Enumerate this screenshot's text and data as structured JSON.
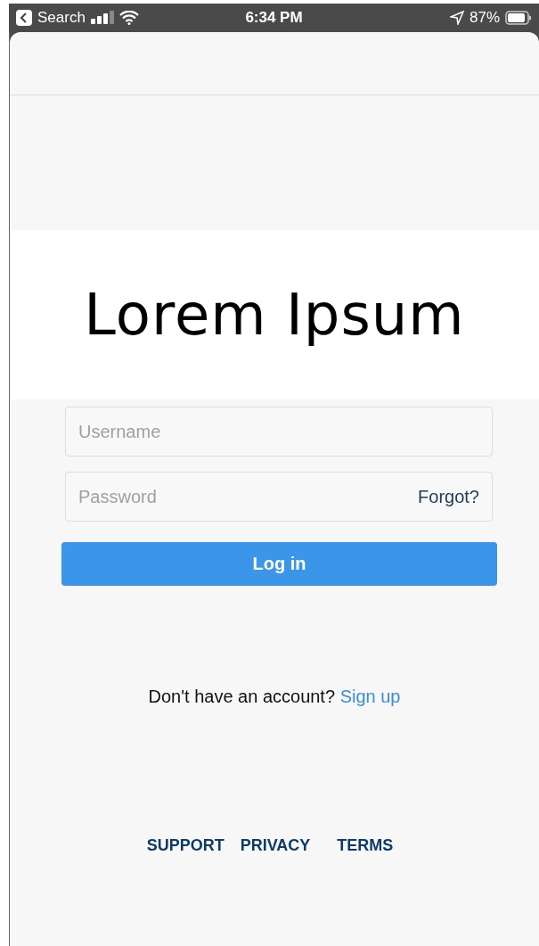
{
  "status_bar": {
    "back_label": "Search",
    "time": "6:34 PM",
    "battery": "87%"
  },
  "logo": "Lorem Ipsum",
  "form": {
    "username": {
      "placeholder": "Username"
    },
    "password": {
      "placeholder": "Password"
    },
    "forgot": "Forgot?",
    "login_button": "Log in"
  },
  "signup": {
    "prompt": "Don't have an account?",
    "link": "Sign up"
  },
  "footer_links": [
    "SUPPORT",
    "PRIVACY",
    "TERMS"
  ]
}
